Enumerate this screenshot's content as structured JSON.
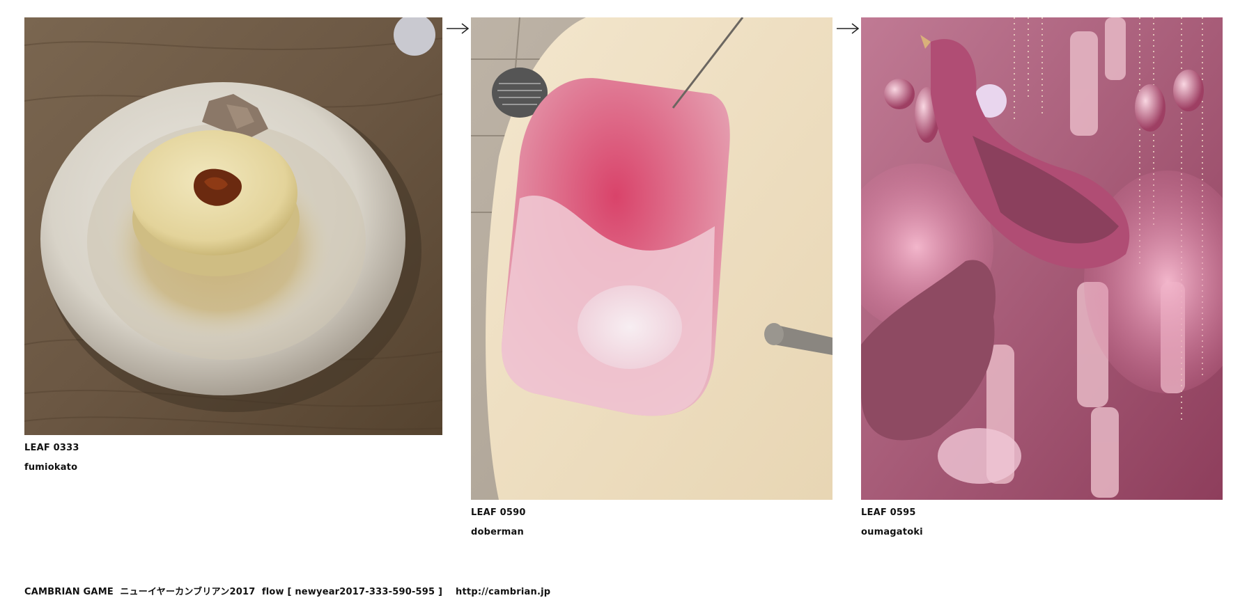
{
  "leaves": [
    {
      "id_label": "LEAF 0333",
      "author": "fumiokato",
      "image_subject": "simmered daikon radish with miso on a ceramic plate on a wooden table"
    },
    {
      "id_label": "LEAF 0590",
      "author": "doberman",
      "image_subject": "bathtub filling with pink foamy bath water"
    },
    {
      "id_label": "LEAF 0595",
      "author": "oumagatoki",
      "image_subject": "pink feathered bird ornaments among pink decorations and baubles"
    }
  ],
  "arrows": [
    {
      "icon": "right-arrow-icon"
    },
    {
      "icon": "right-arrow-icon"
    }
  ],
  "footer": {
    "text": "CAMBRIAN GAME  ニューイヤーカンブリアン2017  flow [ newyear2017-333-590-595 ]    http://cambrian.jp"
  }
}
